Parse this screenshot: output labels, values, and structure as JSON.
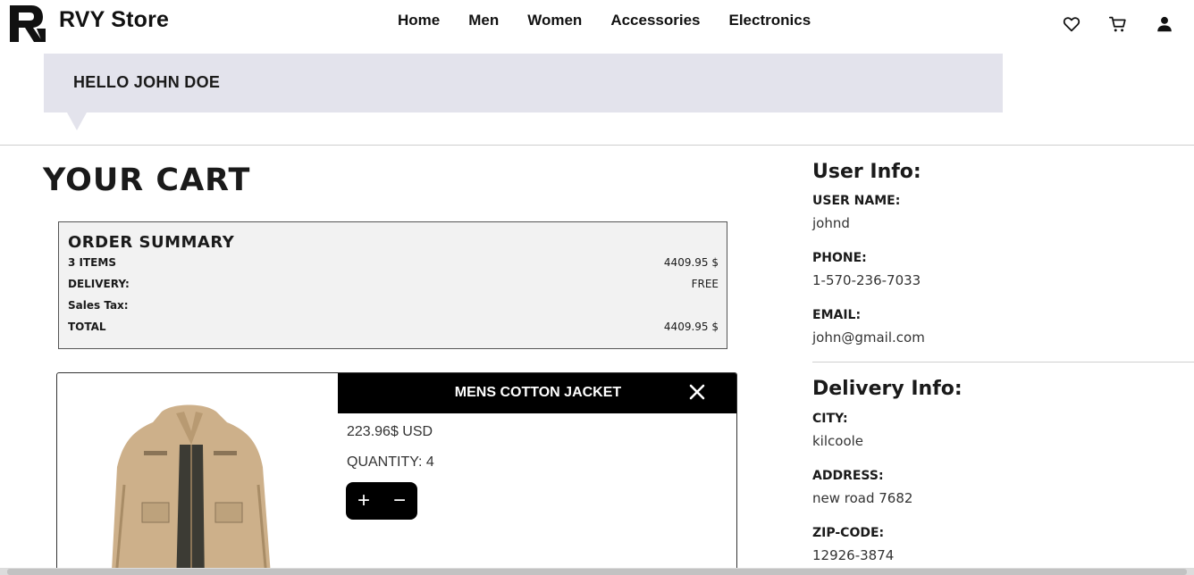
{
  "brand": {
    "name": "RVY Store"
  },
  "nav": [
    "Home",
    "Men",
    "Women",
    "Accessories",
    "Electronics"
  ],
  "header_icons": [
    "heart-icon",
    "cart-icon",
    "user-icon"
  ],
  "greeting": "HELLO JOHN DOE",
  "cart": {
    "title": "YOUR CART",
    "summary": {
      "title": "ORDER SUMMARY",
      "rows": [
        {
          "label": "3 ITEMS",
          "value": "4409.95 $"
        },
        {
          "label": "DELIVERY:",
          "value": "FREE"
        },
        {
          "label": "Sales Tax:",
          "value": ""
        },
        {
          "label": "TOTAL",
          "value": "4409.95 $"
        }
      ]
    },
    "items": [
      {
        "name": "MENS COTTON JACKET",
        "price": "223.96$ USD",
        "quantity": "QUANTITY: 4",
        "increment": "+",
        "decrement": "−"
      }
    ]
  },
  "user_info": {
    "title": "User Info:",
    "fields": [
      {
        "label": "USER NAME:",
        "value": "johnd"
      },
      {
        "label": "PHONE:",
        "value": "1-570-236-7033"
      },
      {
        "label": "EMAIL:",
        "value": "john@gmail.com"
      }
    ]
  },
  "delivery_info": {
    "title": "Delivery Info:",
    "fields": [
      {
        "label": "CITY:",
        "value": "kilcoole"
      },
      {
        "label": "ADDRESS:",
        "value": "new road 7682"
      },
      {
        "label": "ZIP-CODE:",
        "value": "12926-3874"
      }
    ]
  },
  "colors": {
    "greeting_bg": "#e3e3ec",
    "summary_bg": "#f2f2f2",
    "accent": "#000000"
  }
}
